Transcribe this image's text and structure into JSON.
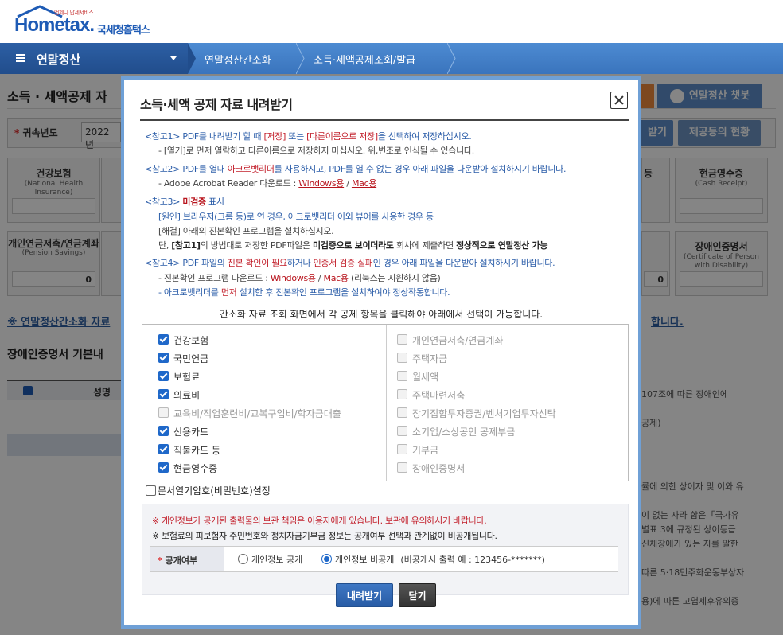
{
  "brand": {
    "tagline": "언제나 납세서비스",
    "name": "Hometax.",
    "name_kr": "국세청홈택스",
    "color": "#1e5bb5"
  },
  "nav": {
    "menu_label": "연말정산",
    "breadcrumbs": [
      "연말정산간소화",
      "소득·세액공제조회/발급"
    ]
  },
  "background": {
    "page_title": "소득 · 세액공제 자",
    "year_label": "귀속년도",
    "year_value": "2022년",
    "button_orange": "",
    "button_chatbot": "연말정산 챗봇",
    "button_download": "받기",
    "button_status": "제공등의 현황",
    "cards": [
      {
        "title": "건강보험",
        "sub": "(National Health Insurance)",
        "value": ""
      },
      {
        "title": "현금영수증",
        "sub": "(Cash Receipt)",
        "value": ""
      },
      {
        "title": "개인연금저축/연금계좌",
        "sub": "(Pension Savings)",
        "value": "0"
      },
      {
        "title": "장애인증명서",
        "sub": "(Certificate of Person with Disability)",
        "value": ""
      }
    ],
    "card_partial_values": [
      "0",
      "0"
    ],
    "card_partial_title": "등",
    "link_left": "※ 연말정산간소화 자료",
    "link_right": "합니다.",
    "section_title": "장애인증명서 기본내",
    "table_header": "성명",
    "side_texts": [
      "107조에 따른 장애인에",
      "공제)",
      "률에 의한 상이자 및 이와 유",
      "이 없는 자라 함은「국가유",
      "별표 3에 규정된 상이등급",
      "신체장애가 있는 자를 말한",
      "따른 5·18민주화운동부상자",
      "용)에 따른 고엽제후유의증"
    ]
  },
  "modal": {
    "title": "소득·세액 공제 자료 내려받기",
    "close_label": "닫기",
    "notes": {
      "n1_a": "<참고1> PDF를 내려받기 할 때 ",
      "n1_b": "[저장]",
      "n1_c": " 또는 ",
      "n1_d": "[다른이름으로 저장]",
      "n1_e": "을 선택하여 저장하십시오.",
      "n1_sub": "- [열기]로 먼저 열람하고 다른이름으로 저장하지 마십시오. 위,변조로 인식될 수 있습니다.",
      "n2_a": "<참고2> PDF를 열때 ",
      "n2_b": "아크로뱃리더",
      "n2_c": "를 사용하시고, PDF를 열 수 없는 경우 아래 파일을 다운받아 설치하시기 바랍니다.",
      "n2_sub": "- Adobe Acrobat Reader 다운로드 : ",
      "link_windows": "Windows용",
      "link_sep": " / ",
      "link_mac": "Mac용",
      "n3_a": "<참고3> ",
      "n3_b": "미검증",
      "n3_c": " 표시",
      "n3_l1": "[원인] 브라우저(크롬 등)로 연 경우, 아크로뱃리더 이외 뷰어를 사용한 경우 등",
      "n3_l2": "[해결] 아래의 진본확인 프로그램을 설치하십시오.",
      "n3_l3_a": "단, ",
      "n3_l3_b": "[참고1]",
      "n3_l3_c": "의 방법대로 저장한 PDF파일은 ",
      "n3_l3_d": "미검증으로 보이더라도",
      "n3_l3_e": " 회사에 제출하면 ",
      "n3_l3_f": "정상적으로 연말정산 가능",
      "n4_a": "<참고4> PDF 파일의 ",
      "n4_b": "진본 확인이 필요",
      "n4_c": "하거나 ",
      "n4_d": "인증서 검증 실패",
      "n4_e": "인 경우 아래 파일을 다운받아 설치하시기 바랍니다.",
      "n4_sub1": "- 진본확인 프로그램 다운로드 : ",
      "n4_sub1_tail": " (리눅스는 지원하지 않음)",
      "n4_sub2_a": "- 아크로뱃리더를 ",
      "n4_sub2_b": "먼저",
      "n4_sub2_c": " 설치한 후 진본확인 프로그램을 설치하여야 정상작동합니다."
    },
    "guide": "간소화 자료 조회 화면에서 각 공제 항목을 클릭해야 아래에서 선택이 가능합니다.",
    "items_left": [
      {
        "label": "건강보험",
        "checked": true,
        "disabled": false
      },
      {
        "label": "국민연금",
        "checked": true,
        "disabled": false
      },
      {
        "label": "보험료",
        "checked": true,
        "disabled": false
      },
      {
        "label": "의료비",
        "checked": true,
        "disabled": false
      },
      {
        "label": "교육비/직업훈련비/교복구입비/학자금대출",
        "checked": false,
        "disabled": true
      },
      {
        "label": "신용카드",
        "checked": true,
        "disabled": false
      },
      {
        "label": "직불카드 등",
        "checked": true,
        "disabled": false
      },
      {
        "label": "현금영수증",
        "checked": true,
        "disabled": false
      }
    ],
    "items_right": [
      {
        "label": "개인연금저축/연금계좌",
        "checked": false,
        "disabled": true
      },
      {
        "label": "주택자금",
        "checked": false,
        "disabled": true
      },
      {
        "label": "월세액",
        "checked": false,
        "disabled": true
      },
      {
        "label": "주택마련저축",
        "checked": false,
        "disabled": true
      },
      {
        "label": "장기집합투자증권/벤처기업투자신탁",
        "checked": false,
        "disabled": true
      },
      {
        "label": "소기업/소상공인 공제부금",
        "checked": false,
        "disabled": true
      },
      {
        "label": "기부금",
        "checked": false,
        "disabled": true
      },
      {
        "label": "장애인증명서",
        "checked": false,
        "disabled": true
      }
    ],
    "password_label": "문서열기암호(비밀번호)설정",
    "info1": "※ 개인정보가 공개된 출력물의 보관 책임은 이용자에게 있습니다. 보관에 유의하시기 바랍니다.",
    "info2": "※ 보험료의 피보험자 주민번호와 정치자금기부금 정보는 공개여부 선택과 관계없이 비공개됩니다.",
    "disclosure_label": "공개여부",
    "radio_public": "개인정보 공개",
    "radio_private": "개인정보 비공개",
    "radio_private_hint": "(비공개시 출력 예 : 123456-*******)",
    "selected_radio": "private",
    "button_download": "내려받기",
    "button_close": "닫기"
  }
}
